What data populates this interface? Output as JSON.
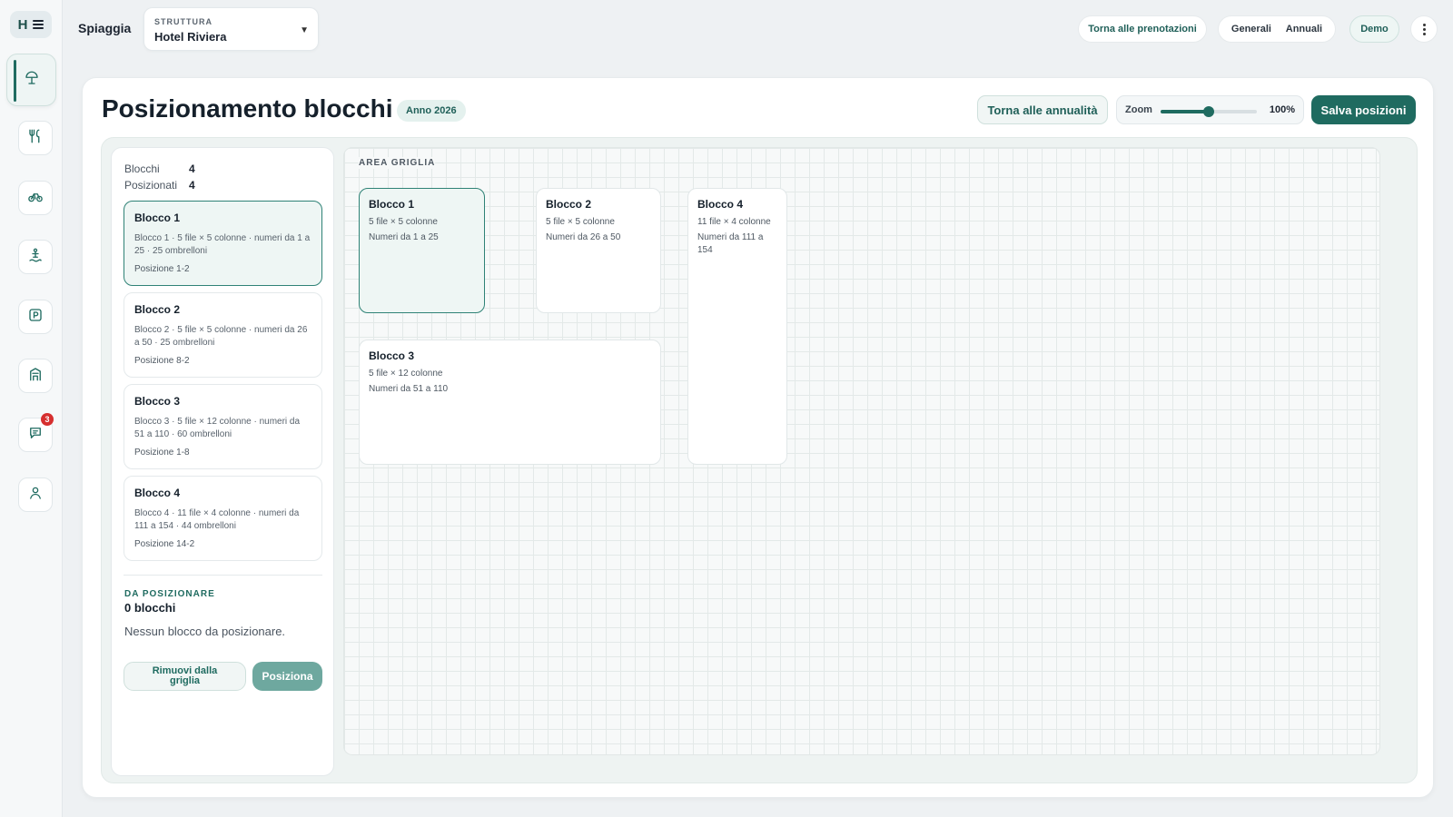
{
  "app": {
    "logo_letter": "H",
    "title": "Spiaggia"
  },
  "rail": {
    "items": [
      {
        "icon": "beach-umbrella-icon",
        "active": true
      },
      {
        "icon": "restaurant-icon"
      },
      {
        "icon": "bike-icon"
      },
      {
        "icon": "lifeguard-icon"
      },
      {
        "icon": "parking-icon"
      },
      {
        "icon": "storefront-icon"
      },
      {
        "icon": "chat-icon",
        "badge": "3"
      },
      {
        "icon": "user-icon"
      }
    ]
  },
  "header": {
    "struttura_label": "STRUTTURA",
    "struttura_value": "Hotel Riviera",
    "back_to_bookings": "Torna alle prenotazioni",
    "segments": [
      "Generali",
      "Annuali"
    ],
    "demo": "Demo"
  },
  "page": {
    "title": "Posizionamento blocchi",
    "year_chip": "Anno 2026",
    "back_button": "Torna alle annualità",
    "zoom_label": "Zoom",
    "zoom_value": "100%",
    "zoom_fraction": 0.5,
    "save_button": "Salva posizioni"
  },
  "panel": {
    "stats": [
      {
        "label": "Blocchi",
        "value": "4"
      },
      {
        "label": "Posizionati",
        "value": "4"
      }
    ],
    "blocks": [
      {
        "title": "Blocco 1",
        "desc": "Blocco 1 · 5 file × 5 colonne · numeri da 1 a 25 · 25 ombrelloni",
        "pos": "Posizione 1-2",
        "selected": true
      },
      {
        "title": "Blocco 2",
        "desc": "Blocco 2 · 5 file × 5 colonne · numeri da 26 a 50 · 25 ombrelloni",
        "pos": "Posizione 8-2"
      },
      {
        "title": "Blocco 3",
        "desc": "Blocco 3 · 5 file × 12 colonne · numeri da 51 a 110 · 60 ombrelloni",
        "pos": "Posizione 1-8"
      },
      {
        "title": "Blocco 4",
        "desc": "Blocco 4 · 11 file × 4 colonne · numeri da 111 a 154 · 44 ombrelloni",
        "pos": "Posizione 14-2"
      }
    ],
    "to_place_label": "DA POSIZIONARE",
    "to_place_count": "0 blocchi",
    "to_place_empty": "Nessun blocco da posizionare.",
    "remove_button": "Rimuovi dalla griglia",
    "place_button": "Posiziona"
  },
  "grid": {
    "label": "AREA GRIGLIA",
    "blocks": [
      {
        "title": "Blocco 1",
        "size": "5 file × 5 colonne",
        "range": "Numeri da 1 a 25",
        "selected": true
      },
      {
        "title": "Blocco 2",
        "size": "5 file × 5 colonne",
        "range": "Numeri da 26 a 50"
      },
      {
        "title": "Blocco 3",
        "size": "5 file × 12 colonne",
        "range": "Numeri da 51 a 110"
      },
      {
        "title": "Blocco 4",
        "size": "11 file × 4 colonne",
        "range": "Numeri da 111 a 154"
      }
    ]
  },
  "colors": {
    "accent": "#1f6b60",
    "badge": "#d62f2f"
  }
}
